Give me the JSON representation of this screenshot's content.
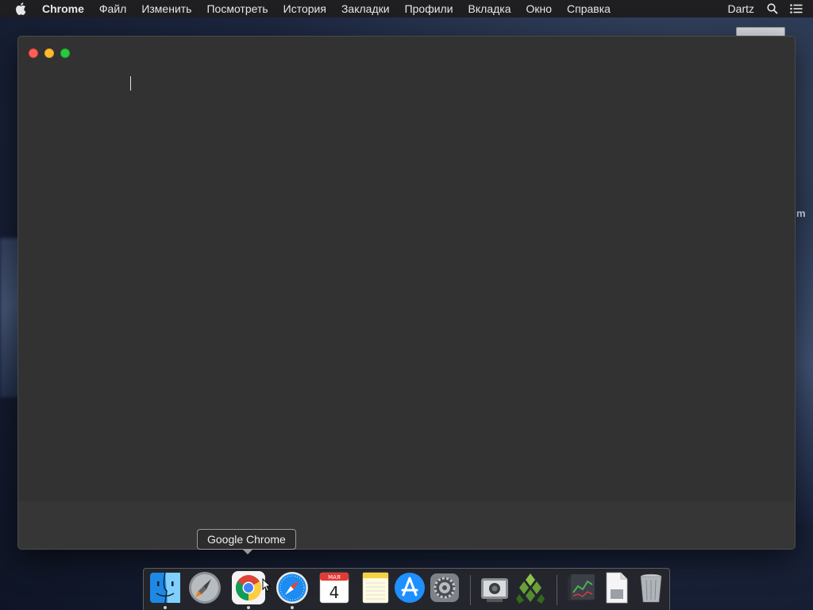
{
  "menubar": {
    "app_name": "Chrome",
    "items": [
      "Файл",
      "Изменить",
      "Посмотреть",
      "История",
      "Закладки",
      "Профили",
      "Вкладка",
      "Окно",
      "Справка"
    ],
    "user": "Dartz"
  },
  "desktop": {
    "peek_text": "m"
  },
  "window": {
    "title": "",
    "traffic_lights": [
      "close",
      "minimize",
      "zoom"
    ]
  },
  "tooltip": {
    "text": "Google Chrome"
  },
  "dock": {
    "apps": [
      {
        "name": "finder-icon",
        "running": true
      },
      {
        "name": "launchpad-icon",
        "running": false
      },
      {
        "name": "google-chrome-icon",
        "running": true
      },
      {
        "name": "safari-icon",
        "running": true
      },
      {
        "name": "calendar-icon",
        "running": false,
        "month": "МАЯ",
        "day": "4"
      },
      {
        "name": "notes-icon",
        "running": false
      },
      {
        "name": "app-store-icon",
        "running": false
      },
      {
        "name": "system-preferences-icon",
        "running": false
      },
      {
        "name": "image-capture-icon",
        "running": false
      },
      {
        "name": "green-pyramid-app-icon",
        "running": false
      },
      {
        "name": "stocks-folder-icon",
        "running": false
      },
      {
        "name": "document-icon",
        "running": false
      },
      {
        "name": "trash-icon",
        "running": false
      }
    ]
  },
  "colors": {
    "menubar_bg": "#1f1f22",
    "window_bg": "#323232",
    "close": "#fe5f57",
    "minimize": "#febc2e",
    "zoom": "#28c840"
  }
}
